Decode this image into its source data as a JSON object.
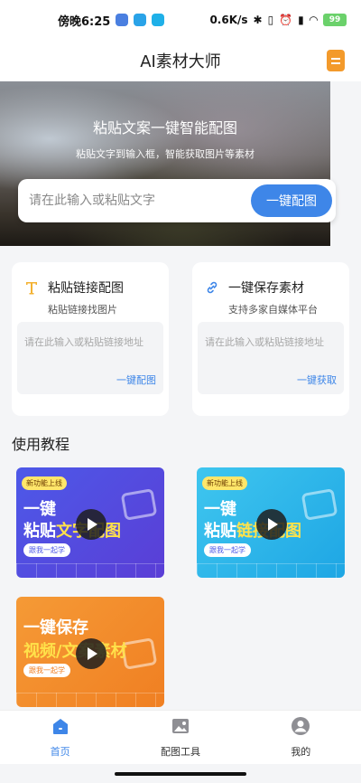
{
  "status_bar": {
    "time": "傍晚6:25",
    "network_speed": "0.6K/s",
    "battery": "99"
  },
  "header": {
    "title": "AI素材大师",
    "menu_icon": "document-icon"
  },
  "banner": {
    "title": "粘贴文案一键智能配图",
    "subtitle": "粘贴文字到输入框，智能获取图片等素材",
    "input_placeholder": "请在此输入或粘贴文字",
    "button_label": "一键配图"
  },
  "cards": [
    {
      "title": "粘贴链接配图",
      "subtitle": "粘贴链接找图片",
      "placeholder": "请在此输入或粘贴链接地址",
      "action": "一键配图",
      "icon": "text-t-icon",
      "icon_color": "#f3b233"
    },
    {
      "title": "一键保存素材",
      "subtitle": "支持多家自媒体平台",
      "placeholder": "请在此输入或粘贴链接地址",
      "action": "一键获取",
      "icon": "link-icon",
      "icon_color": "#3e86e8"
    }
  ],
  "tutorials": {
    "section_title": "使用教程",
    "items": [
      {
        "tag": "新功能上线",
        "line1": "一键",
        "line2_a": "粘贴",
        "line2_b": "文字配图",
        "pill": "跟我一起学"
      },
      {
        "tag": "新功能上线",
        "line1": "一键",
        "line2_a": "粘贴",
        "line2_b": "链接配图",
        "pill": "跟我一起学"
      },
      {
        "tag": "",
        "line1": "一键保存",
        "line2_a": "",
        "line2_b": "视频/文案素材",
        "pill": "跟我一起学"
      }
    ]
  },
  "bottom_nav": [
    {
      "label": "首页",
      "icon": "home-icon",
      "active": true
    },
    {
      "label": "配图工具",
      "icon": "image-icon",
      "active": false
    },
    {
      "label": "我的",
      "icon": "user-icon",
      "active": false
    }
  ],
  "colors": {
    "accent": "#3e86e8",
    "orange": "#f39a2b"
  }
}
